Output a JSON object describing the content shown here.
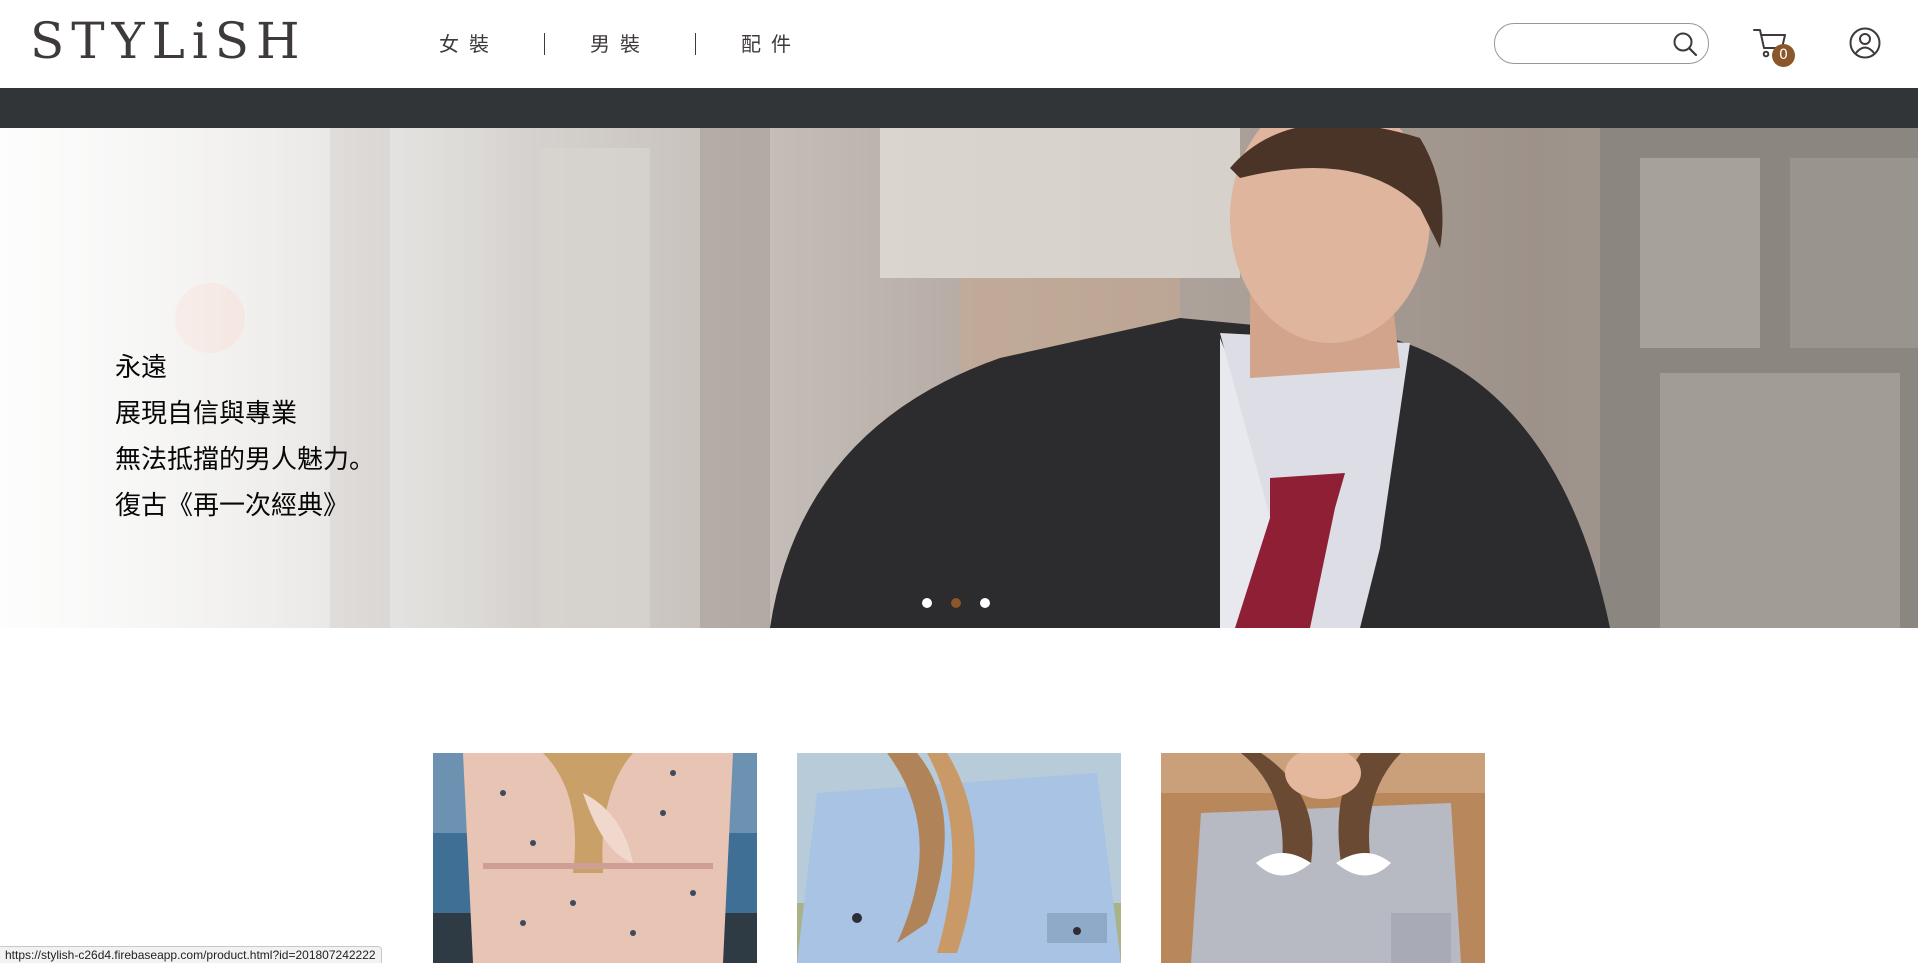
{
  "header": {
    "logo_text": "STYLiSH",
    "nav": [
      {
        "label": "女裝"
      },
      {
        "label": "男裝"
      },
      {
        "label": "配件"
      }
    ],
    "search": {
      "value": "",
      "placeholder": ""
    },
    "cart_count": "0"
  },
  "hero": {
    "lines": [
      "永遠",
      "展現自信與專業",
      "無法抵擋的男人魅力。",
      "復古《再一次經典》"
    ],
    "dots": [
      {
        "state": "inactive"
      },
      {
        "state": "active"
      },
      {
        "state": "inactive"
      }
    ]
  },
  "products": [
    {
      "image": "pink-floral-dress-photo"
    },
    {
      "image": "light-blue-blouse-photo"
    },
    {
      "image": "grey-shirt-photo"
    }
  ],
  "status_bar": {
    "url": "https://stylish-c26d4.firebaseapp.com/product.html?id=201807242222"
  },
  "colors": {
    "accent": "#8b572a",
    "text": "#3f3a3a",
    "dark_bar": "#313538"
  },
  "icons": [
    "search-icon",
    "cart-icon",
    "member-icon"
  ]
}
